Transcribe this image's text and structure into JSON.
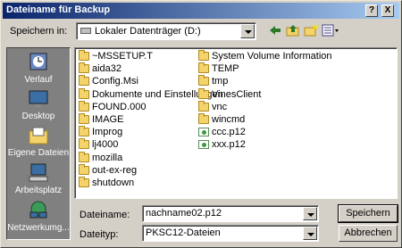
{
  "window": {
    "title": "Dateiname für Backup",
    "help_label": "?",
    "close_label": "X"
  },
  "toolbar": {
    "look_in_label": "Speichern in:",
    "look_in_value": "Lokaler Datenträger (D:)"
  },
  "places": [
    {
      "label": "Verlauf",
      "icon": "history-icon"
    },
    {
      "label": "Desktop",
      "icon": "desktop-icon"
    },
    {
      "label": "Eigene Dateien",
      "icon": "my-documents-icon"
    },
    {
      "label": "Arbeitsplatz",
      "icon": "my-computer-icon"
    },
    {
      "label": "Netzwerkumg...",
      "icon": "network-icon"
    }
  ],
  "files": {
    "col1": [
      {
        "name": "~MSSETUP.T",
        "type": "folder"
      },
      {
        "name": "aida32",
        "type": "folder"
      },
      {
        "name": "Config.Msi",
        "type": "folder"
      },
      {
        "name": "Dokumente und Einstellungen",
        "type": "folder"
      },
      {
        "name": "FOUND.000",
        "type": "folder"
      },
      {
        "name": "IMAGE",
        "type": "folder"
      },
      {
        "name": "Improg",
        "type": "folder"
      },
      {
        "name": "lj4000",
        "type": "folder"
      },
      {
        "name": "mozilla",
        "type": "folder"
      },
      {
        "name": "out-ex-reg",
        "type": "folder"
      },
      {
        "name": "shutdown",
        "type": "folder"
      }
    ],
    "col2": [
      {
        "name": "System Volume Information",
        "type": "folder"
      },
      {
        "name": "TEMP",
        "type": "folder"
      },
      {
        "name": "tmp",
        "type": "folder"
      },
      {
        "name": "VinesClient",
        "type": "folder"
      },
      {
        "name": "vnc",
        "type": "folder"
      },
      {
        "name": "wincmd",
        "type": "folder"
      },
      {
        "name": "ccc.p12",
        "type": "certificate"
      },
      {
        "name": "xxx.p12",
        "type": "certificate"
      }
    ]
  },
  "form": {
    "filename_label": "Dateiname:",
    "filename_value": "nachname02.p12",
    "filetype_label": "Dateityp:",
    "filetype_value": "PKSC12-Dateien"
  },
  "buttons": {
    "save": "Speichern",
    "cancel": "Abbrechen"
  }
}
